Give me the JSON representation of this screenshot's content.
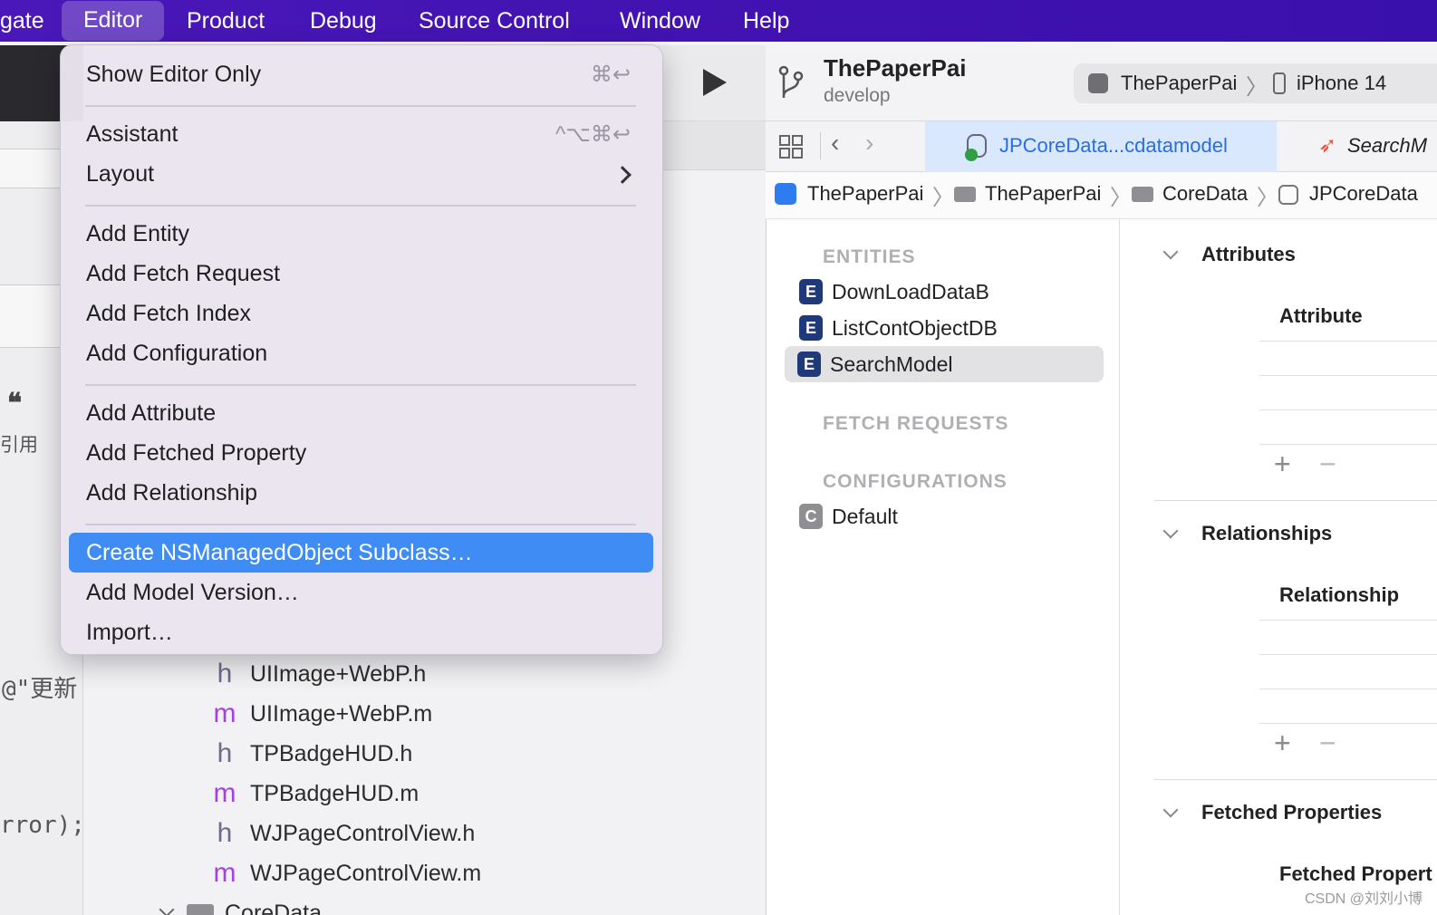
{
  "menubar": {
    "items": [
      "gate",
      "Editor",
      "Product",
      "Debug",
      "Source Control",
      "Window",
      "Help"
    ],
    "active": "Editor",
    "color": "#4a17b8"
  },
  "editor_menu": {
    "items": [
      {
        "label": "Show Editor Only",
        "shortcut": "⌘↩"
      },
      {
        "label": "Assistant",
        "shortcut": "^⌥⌘↩"
      },
      {
        "label": "Layout",
        "submenu": true
      },
      {
        "label": "Add Entity"
      },
      {
        "label": "Add Fetch Request"
      },
      {
        "label": "Add Fetch Index"
      },
      {
        "label": "Add Configuration"
      },
      {
        "label": "Add Attribute"
      },
      {
        "label": "Add Fetched Property"
      },
      {
        "label": "Add Relationship"
      },
      {
        "label": "Create NSManagedObject Subclass…",
        "highlighted": true
      },
      {
        "label": "Add Model Version…"
      },
      {
        "label": "Import…"
      }
    ],
    "highlight_color": "#3f8cf4"
  },
  "left_fragments": {
    "quote_glyph": "66",
    "quote_label": "引用",
    "code1": "@\"更新",
    "code2": "rror);"
  },
  "navigator": {
    "files": [
      {
        "type": "h",
        "name": "UIImage+WebP.h"
      },
      {
        "type": "m",
        "name": "UIImage+WebP.m"
      },
      {
        "type": "h",
        "name": "TPBadgeHUD.h"
      },
      {
        "type": "m",
        "name": "TPBadgeHUD.m"
      },
      {
        "type": "h",
        "name": "WJPageControlView.h"
      },
      {
        "type": "m",
        "name": "WJPageControlView.m"
      }
    ],
    "folder": "CoreData"
  },
  "project": {
    "name": "ThePaperPai",
    "branch": "develop",
    "scheme": "ThePaperPai",
    "device": "iPhone 14"
  },
  "tabs": {
    "active": "JPCoreData...cdatamodel",
    "next": "SearchM"
  },
  "breadcrumb": [
    "ThePaperPai",
    "ThePaperPai",
    "CoreData",
    "JPCoreData"
  ],
  "model_editor": {
    "entities_header": "ENTITIES",
    "entities": [
      "DownLoadDataB",
      "ListContObjectDB",
      "SearchModel"
    ],
    "selected_entity": "SearchModel",
    "fetch_requests_header": "FETCH REQUESTS",
    "configurations_header": "CONFIGURATIONS",
    "configurations": [
      "Default"
    ],
    "sections": {
      "attributes": {
        "title": "Attributes",
        "column": "Attribute"
      },
      "relationships": {
        "title": "Relationships",
        "column": "Relationship"
      },
      "fetched": {
        "title": "Fetched Properties",
        "column": "Fetched Propert"
      }
    }
  },
  "watermark": "CSDN @刘刘小博"
}
